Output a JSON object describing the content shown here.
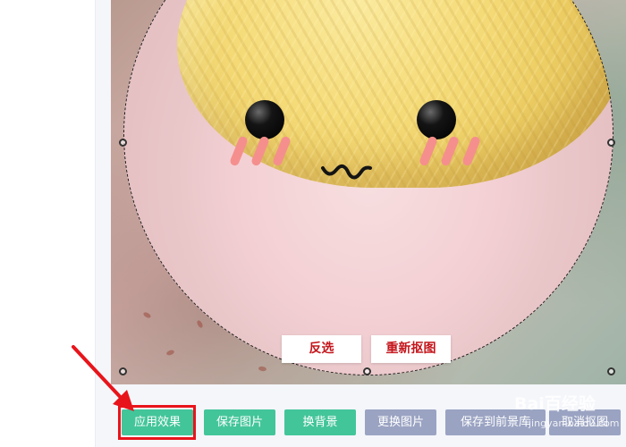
{
  "canvas": {
    "overlay_buttons": {
      "invert_selection": "反选",
      "recut": "重新抠图"
    }
  },
  "toolbar": {
    "apply_effect": "应用效果",
    "save_image": "保存图片",
    "change_background": "换背景",
    "replace_image": "更换图片",
    "save_to_library": "保存到前景库",
    "cancel_cutout": "取消抠图"
  },
  "watermark": {
    "brand": "Bai百经验",
    "sub": "jingyan.baidu.com"
  },
  "colors": {
    "green_button": "#43c59a",
    "gray_button": "#9aa3c2",
    "annotation_red": "#e8141b",
    "overlay_text_red": "#c4161c"
  },
  "icons": [
    "annotation-arrow-icon",
    "selection-handle-icon"
  ]
}
